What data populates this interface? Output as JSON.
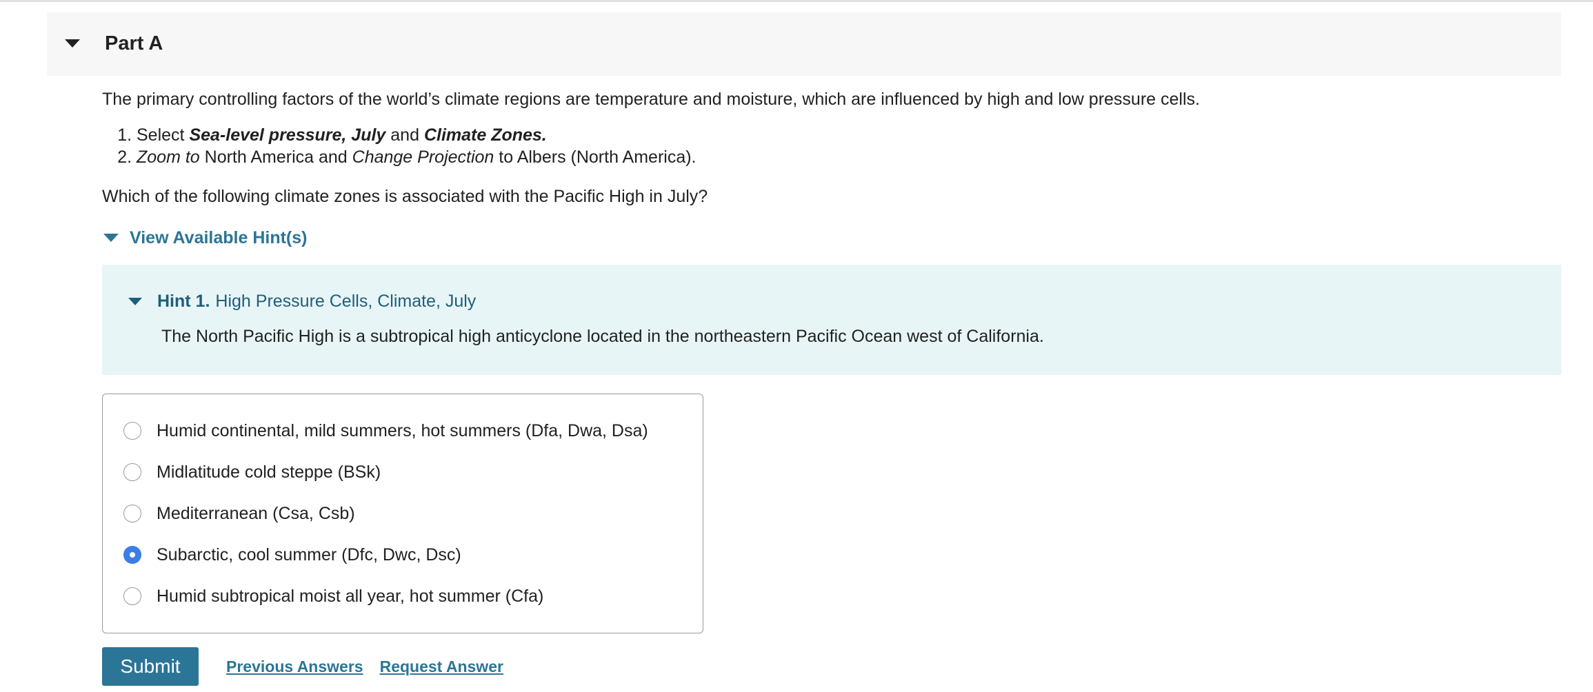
{
  "part": {
    "title": "Part A"
  },
  "intro": "The primary controlling factors of the world’s climate regions are temperature and moisture, which are influenced by high and low pressure cells.",
  "steps": [
    {
      "pre": "Select ",
      "em1": "Sea-level pressure, July",
      "mid": " and ",
      "em2": "Climate Zones."
    },
    {
      "em1": "Zoom to",
      "mid": " North America and ",
      "em2": "Change Projection",
      "post": " to Albers (North America)."
    }
  ],
  "question": "Which of the following climate zones is associated with the Pacific High in July?",
  "hints": {
    "toggle_label": "View Available Hint(s)",
    "items": [
      {
        "number": "Hint 1.",
        "title": "High Pressure Cells, Climate, July",
        "body": "The North Pacific High is a subtropical high anticyclone located in the northeastern Pacific Ocean west of California."
      }
    ]
  },
  "options": [
    {
      "label": "Humid continental, mild summers, hot summers (Dfa, Dwa, Dsa)",
      "selected": false
    },
    {
      "label": "Midlatitude cold steppe (BSk)",
      "selected": false
    },
    {
      "label": "Mediterranean (Csa, Csb)",
      "selected": false
    },
    {
      "label": "Subarctic, cool summer (Dfc, Dwc, Dsc)",
      "selected": true
    },
    {
      "label": "Humid subtropical moist all year, hot summer (Cfa)",
      "selected": false
    }
  ],
  "actions": {
    "submit_label": "Submit",
    "previous_answers_label": "Previous Answers",
    "request_answer_label": "Request Answer"
  },
  "colors": {
    "link": "#2b7596",
    "radio_selected": "#3b7ee5",
    "hint_background": "#e8f5f6"
  }
}
